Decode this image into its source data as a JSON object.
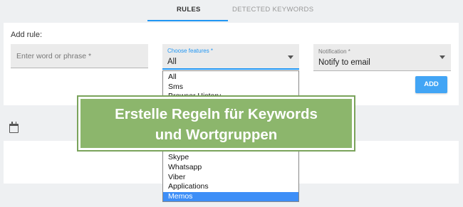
{
  "tabs": [
    {
      "label": "RULES",
      "active": true
    },
    {
      "label": "DETECTED KEYWORDS",
      "active": false
    }
  ],
  "form": {
    "add_rule_label": "Add rule:",
    "word_placeholder": "Enter word or phrase *",
    "features_label": "Choose features *",
    "features_value": "All",
    "notification_label": "Notification *",
    "notification_value": "Notify to email",
    "add_button": "ADD"
  },
  "dropdown": {
    "items": [
      {
        "label": "All",
        "selected": false
      },
      {
        "label": "Sms",
        "selected": false
      },
      {
        "label": "Browser History",
        "selected": false
      },
      {
        "label": "Skype",
        "selected": false
      },
      {
        "label": "Whatsapp",
        "selected": false
      },
      {
        "label": "Viber",
        "selected": false
      },
      {
        "label": "Applications",
        "selected": false
      },
      {
        "label": "Memos",
        "selected": true
      }
    ]
  },
  "banner": {
    "line1": "Erstelle Regeln für Keywords",
    "line2": "und Wortgruppen"
  },
  "colors": {
    "accent": "#2196f3",
    "add_button": "#42a5f5",
    "selected_item": "#3d8ef7",
    "banner": "#8cb66c"
  },
  "icons": {
    "calendar": "calendar-icon",
    "dropdown_caret": "chevron-down-icon"
  }
}
